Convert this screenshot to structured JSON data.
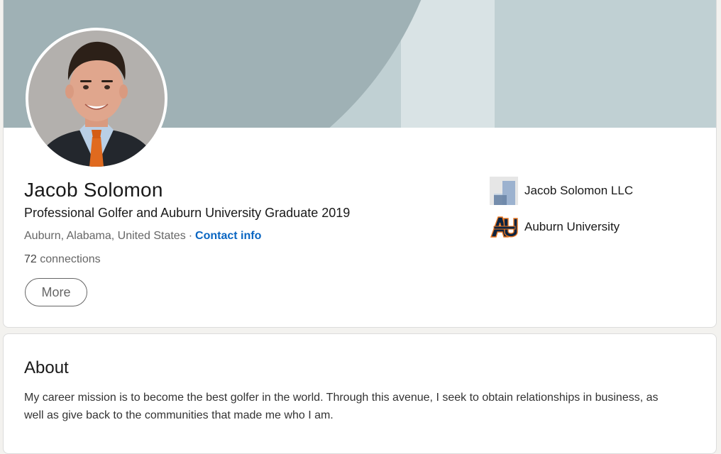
{
  "profile": {
    "name": "Jacob Solomon",
    "headline": "Professional Golfer and Auburn University Graduate 2019",
    "location": "Auburn, Alabama, United States",
    "separator": "·",
    "contact_label": "Contact info",
    "connections_count": "72",
    "connections_label": "connections",
    "more_label": "More"
  },
  "organizations": [
    {
      "name": "Jacob Solomon LLC",
      "icon": "company-logo-icon"
    },
    {
      "name": "Auburn University",
      "icon": "auburn-au-logo-icon"
    }
  ],
  "about": {
    "title": "About",
    "text": "My career mission is to become the best golfer in the world. Through this avenue, I seek to obtain relationships in business, as well as give back to the communities that made me who I am."
  },
  "colors": {
    "banner_light": "#c0d0d3",
    "banner_dark": "#9fb1b5",
    "link": "#0a66c2",
    "auburn_navy": "#0c2340",
    "auburn_orange": "#e87722"
  }
}
